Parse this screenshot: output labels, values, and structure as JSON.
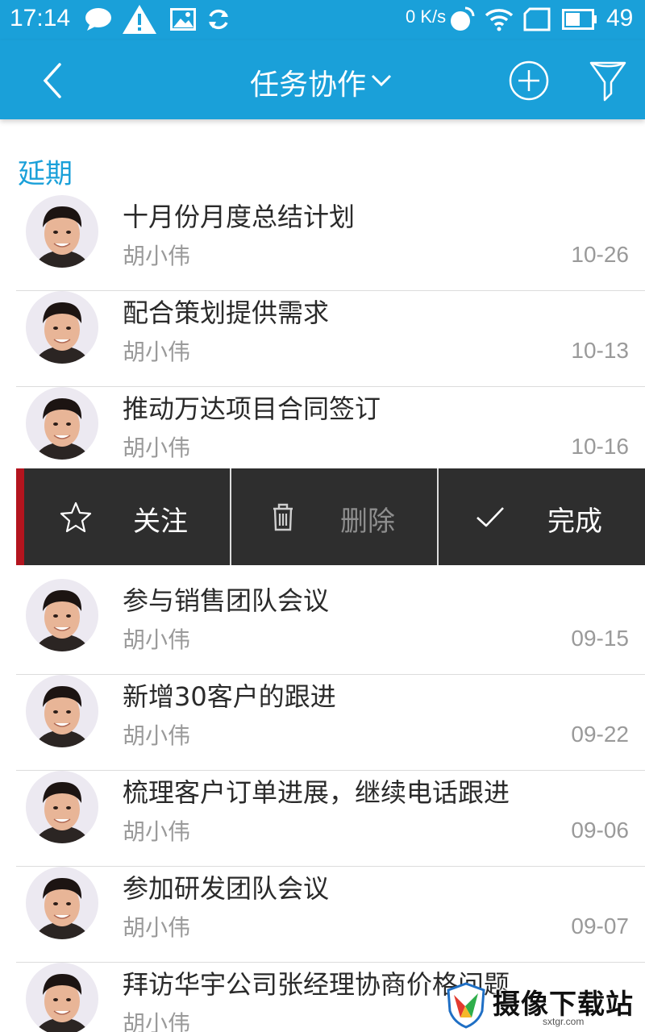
{
  "status_bar": {
    "time": "17:14",
    "net_speed": "0 K/s",
    "battery": "49",
    "icons": [
      "chat-icon",
      "warning-icon",
      "image-icon",
      "sync-icon",
      "nfc-icon",
      "wifi-icon",
      "signal-icon",
      "battery-icon"
    ]
  },
  "app_bar": {
    "title": "任务协作",
    "back_icon": "back-chevron-icon",
    "add_icon": "add-circle-icon",
    "filter_icon": "filter-funnel-icon",
    "color": "#1aa0d9"
  },
  "section": {
    "label": "延期"
  },
  "tasks": [
    {
      "title": "十月份月度总结计划",
      "owner": "胡小伟",
      "date": "10-26"
    },
    {
      "title": "配合策划提供需求",
      "owner": "胡小伟",
      "date": "10-13"
    },
    {
      "title": "推动万达项目合同签订",
      "owner": "胡小伟",
      "date": "10-16"
    },
    {
      "title": "参与销售团队会议",
      "owner": "胡小伟",
      "date": "09-15"
    },
    {
      "title": "新增30客户的跟进",
      "owner": "胡小伟",
      "date": "09-22"
    },
    {
      "title": "梳理客户订单进展，继续电话跟进",
      "owner": "胡小伟",
      "date": "09-06"
    },
    {
      "title": "参加研发团队会议",
      "owner": "胡小伟",
      "date": "09-07"
    },
    {
      "title": "拜访华宇公司张经理协商价格问题",
      "owner": "胡小伟",
      "date": ""
    }
  ],
  "swipe_actions": {
    "follow": "关注",
    "delete": "删除",
    "complete": "完成"
  },
  "watermark": {
    "text": "摄像下载站",
    "sub": "sxtgr.com"
  }
}
